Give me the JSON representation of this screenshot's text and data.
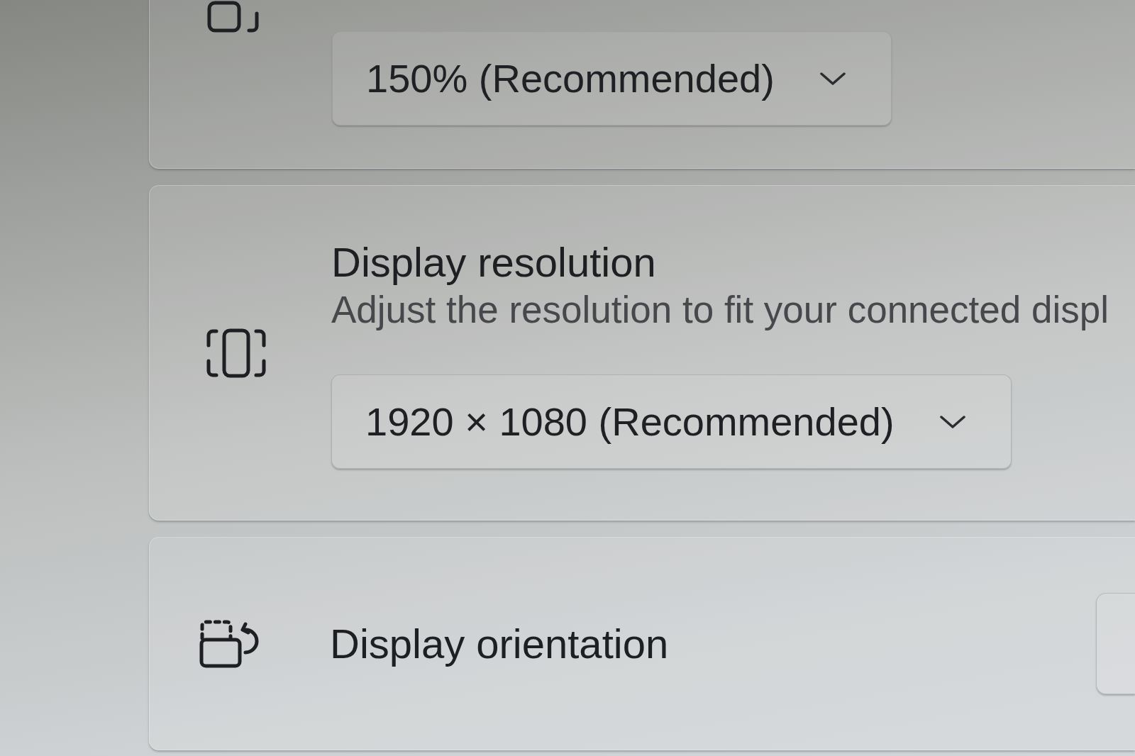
{
  "cards": [
    {
      "kind": "scale",
      "dropdown": {
        "value": "150% (Recommended)"
      }
    },
    {
      "kind": "resolution",
      "title": "Display resolution",
      "description": "Adjust the resolution to fit your connected displ",
      "dropdown": {
        "value": "1920 × 1080 (Recommended)"
      }
    },
    {
      "kind": "orientation",
      "title": "Display orientation"
    }
  ]
}
